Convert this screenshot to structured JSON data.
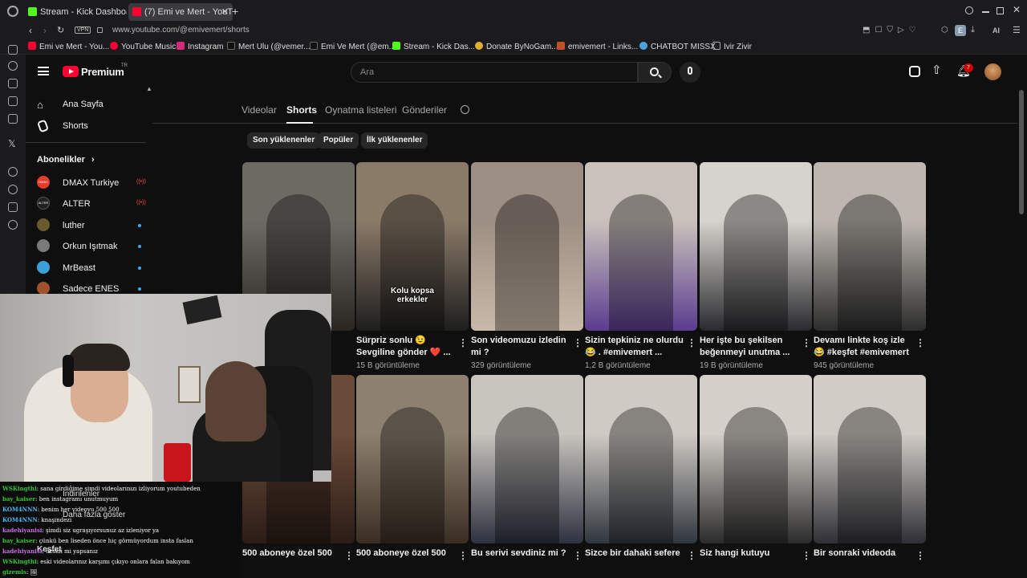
{
  "browser": {
    "tabs": [
      {
        "label": "Stream - Kick Dashboard",
        "color": "#53fc18"
      },
      {
        "label": "(7) Emi ve Mert - YouTube",
        "color": "#ff0033"
      }
    ],
    "vpn": "VPN",
    "url": "www.youtube.com/@emivemert/shorts",
    "bookmarks": [
      {
        "label": "Emi ve Mert - You...",
        "color": "#ff0033"
      },
      {
        "label": "YouTube Music",
        "color": "#ff0033"
      },
      {
        "label": "Instagram",
        "color": "#d62976"
      },
      {
        "label": "Mert Ulu (@vemer...",
        "color": "#111111"
      },
      {
        "label": "Emi Ve Mert (@em...",
        "color": "#111111"
      },
      {
        "label": "Stream - Kick Das...",
        "color": "#53fc18"
      },
      {
        "label": "Donate ByNoGam...",
        "color": "#e0b030"
      },
      {
        "label": "emivemert - Links...",
        "color": "#c0502a"
      },
      {
        "label": "CHATBOT MISSX",
        "color": "#4aa3df"
      },
      {
        "label": "Ivir Zivir",
        "color": "#888888"
      }
    ],
    "extension_badge": "E",
    "ai_label": "AI"
  },
  "youtube": {
    "logo_text": "Premium",
    "logo_region": "TR",
    "search_placeholder": "Ara",
    "notification_count": "7",
    "sidebar": {
      "home": "Ana Sayfa",
      "shorts": "Shorts",
      "subscriptions_title": "Abonelikler",
      "channels": [
        {
          "name": "DMAX Turkiye",
          "live": true,
          "avatar_color": "#e43b2b",
          "avatar_text": "DMAX"
        },
        {
          "name": "ALTER",
          "live": true,
          "avatar_color": "#222222",
          "avatar_text": "ALTER"
        },
        {
          "name": "luther",
          "live": false,
          "avatar_color": "#6b5a2e",
          "avatar_text": ""
        },
        {
          "name": "Orkun Işıtmak",
          "live": false,
          "avatar_color": "#7a7a7a",
          "avatar_text": ""
        },
        {
          "name": "MrBeast",
          "live": false,
          "avatar_color": "#3aa0d8",
          "avatar_text": ""
        },
        {
          "name": "Sadece ENES",
          "live": false,
          "avatar_color": "#a0522d",
          "avatar_text": ""
        }
      ]
    },
    "channel_tabs": [
      "Videolar",
      "Shorts",
      "Oynatma listeleri",
      "Gönderiler"
    ],
    "active_tab": "Shorts",
    "chips": [
      "Son yüklenenler",
      "Popüler",
      "İlk yüklenenler"
    ],
    "shorts_row1": [
      {
        "title_l1": "",
        "title_l2": "",
        "views": "",
        "colors": [
          "#6d6a64",
          "#2a2623"
        ]
      },
      {
        "title_l1": "Sürpriz sonlu 😉",
        "title_l2": "Sevgiline gönder ❤️ ...",
        "views": "15 B görüntüleme",
        "colors": [
          "#8a7a68",
          "#1e1e1e"
        ],
        "overlay": "Kolu kopsa erkekler"
      },
      {
        "title_l1": "Son videomuzu izledin",
        "title_l2": "mi ?",
        "views": "329 görüntüleme",
        "colors": [
          "#9e8f84",
          "#c9b9a8"
        ]
      },
      {
        "title_l1": "Sizin tepkiniz ne olurdu",
        "title_l2": "😂 . #emivemert ...",
        "views": "1,2 B görüntüleme",
        "colors": [
          "#c9c2bb",
          "#5b3c8f"
        ]
      },
      {
        "title_l1": "Her işte bu şekilsen",
        "title_l2": "beğenmeyi unutma ...",
        "views": "19 B görüntüleme",
        "colors": [
          "#d6d2cd",
          "#2a2a2e"
        ]
      },
      {
        "title_l1": "Devamı linkte koş izle",
        "title_l2": "😂 #keşfet #emivemert",
        "views": "945 görüntüleme",
        "colors": [
          "#bdb7b0",
          "#2c2c2c"
        ]
      }
    ],
    "shorts_row2": [
      {
        "title_l1": "500 aboneye özel 500",
        "colors": [
          "#6a4a38",
          "#2a1c16"
        ]
      },
      {
        "title_l1": "500 aboneye özel 500",
        "colors": [
          "#8c8070",
          "#3a2d22"
        ]
      },
      {
        "title_l1": "Bu serivi sevdiniz mi ?",
        "colors": [
          "#c8c4be",
          "#2e3140"
        ]
      },
      {
        "title_l1": "Sizce bir dahaki sefere",
        "colors": [
          "#cfcac4",
          "#30363e"
        ]
      },
      {
        "title_l1": "Siz hangi kutuyu",
        "colors": [
          "#d4cfc9",
          "#2b2b2b"
        ]
      },
      {
        "title_l1": "Bir sonraki videoda",
        "colors": [
          "#d1ccc6",
          "#2f2f35"
        ]
      }
    ],
    "partial_menu": [
      "İndirilenler",
      "Daha fazla göster",
      "Keşfet"
    ]
  },
  "stream": {
    "chat": [
      {
        "user": "WSKingthi",
        "color": "#35c435",
        "msg": "sana girdiğime şimdi videolarınızı izliyorum youtubeden"
      },
      {
        "user": "bay_kaiser",
        "color": "#35c435",
        "msg": "ben instagramı unutmuyum"
      },
      {
        "user": "KOM4NNN",
        "color": "#4ab8f0",
        "msg": "benim her videoyu 500 500"
      },
      {
        "user": "KOM4NNN",
        "color": "#4ab8f0",
        "msg": "knaşindezi"
      },
      {
        "user": "kadehiyanisi",
        "color": "#c86ce0",
        "msg": "şimdi siz ugraşıyorsunuz az izleniyor ya"
      },
      {
        "user": "bay_kaiser",
        "color": "#35c435",
        "msg": "çünkü ben liseden önce hiç görmüyordum insta faslan"
      },
      {
        "user": "kadehiyanisi",
        "color": "#c86ce0",
        "msg": "üzsini mi yapsanız"
      },
      {
        "user": "WSKingthi",
        "color": "#35c435",
        "msg": "eski videolarınız karşımı çıkıyo onlara falan bakıyom"
      },
      {
        "user": "gizemls",
        "color": "#35c435",
        "msg": "🖼"
      }
    ]
  }
}
